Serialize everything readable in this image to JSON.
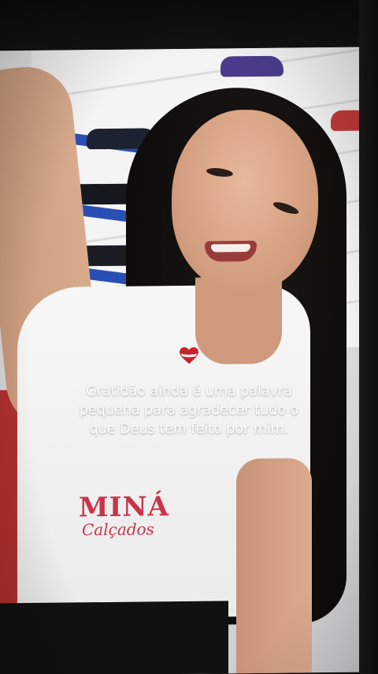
{
  "story": {
    "caption_lines": [
      "Gratidão ainda é uma palavra",
      "pequena para agradecer tudo o",
      "que Deus tem feito por mim."
    ],
    "caption": "Gratidão ainda é uma palavra\npequena para agradecer tudo o\nque Deus tem feito por mim.",
    "sticker_icon": "heart-icon"
  },
  "photo": {
    "shirt_logo_main": "MINÁ",
    "shirt_logo_sub": "Calçados"
  },
  "colors": {
    "background": "#0f0f0f",
    "caption_text": "#ffffff",
    "heart_red": "#c8232c",
    "logo_red": "#c8344a"
  }
}
